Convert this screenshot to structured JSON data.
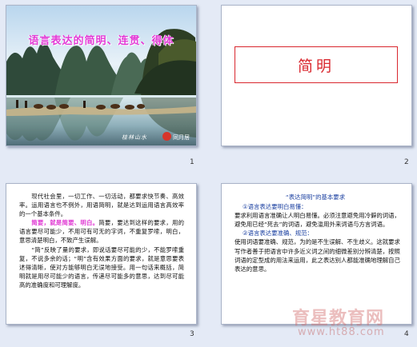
{
  "slides": [
    {
      "number": "1",
      "title": "语言表达的简明、连贯、得体",
      "caption": "桂林山水",
      "brand": "同月居"
    },
    {
      "number": "2",
      "heading": "简明"
    },
    {
      "number": "3",
      "p1": "　　现代社会里，一切工作、一切活动，都要求快节奏、高效率。运用语言也不例外，用语简明，就是达到运用语言高效率的一个基本条件。",
      "p2_highlight": "简要，就是简要、明白。",
      "p2_rest": "简要，要达到这样的要求，用的语言要尽可能少，不用可有可无的字词，不重复罗嗦，明白，意思清楚明白，不致产生误解。",
      "p3": "　　“简”反映了量的要求，即说话要尽可能的少，不能罗嗦重复，不说多余的话；“明”含有效果方面的要求，就是意思要表述得清晰，使对方能够明白无误地接受。用一句话来概括，简明就是用尽可能少的语言，传递尽可能多的意思，达到尽可能高的准确度和可理解度。"
    },
    {
      "number": "4",
      "title": "“表达简明”的基本要求",
      "item1": "①语言表达要明白易懂：",
      "item1_text": "要求利用语言准确让人明白易懂。必须注意避免用冷僻的词语，避免用已经“死去”的词语，避免滥用外来词语与方言词语。",
      "item2": "②语言表达要准确、规范：",
      "item2_text": "使用词语要准确、规范，为的是不生误解、不生歧义。这就要求写作者善于把语言中许多近义词之间的细微差别分辨清楚，按照词语的定型成的用法来运用，此之表达别人都能准确地理解自己表达的意思。"
    }
  ],
  "watermark": {
    "site_name": "育星教育网",
    "url": "www.ht88.com"
  }
}
